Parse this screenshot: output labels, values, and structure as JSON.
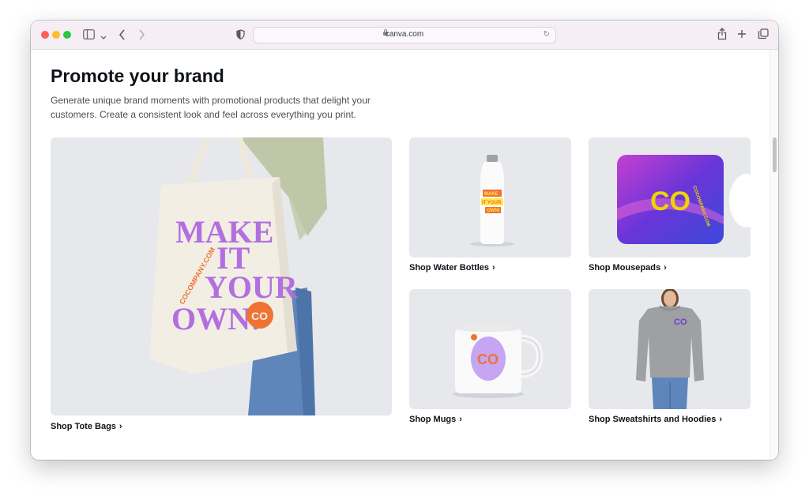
{
  "browser": {
    "url": "canva.com"
  },
  "section": {
    "title": "Promote your brand",
    "description": "Generate unique brand moments with promotional products that delight your customers. Create a consistent look and feel across everything you print."
  },
  "products": [
    {
      "label": "Shop Tote Bags"
    },
    {
      "label": "Shop Water Bottles"
    },
    {
      "label": "Shop Mousepads"
    },
    {
      "label": "Shop Mugs"
    },
    {
      "label": "Shop Sweatshirts and Hoodies"
    }
  ],
  "artwork": {
    "tote_text": [
      "MAKE",
      "IT",
      "YOUR",
      "OWN!"
    ],
    "tote_arc": "COCOMPANY.COM",
    "logo": "CO",
    "bottle_text": [
      "MAKE",
      "IT YOUR",
      "OWN!"
    ],
    "mousepad_arc": "COCOMPANY.COM"
  },
  "colors": {
    "tote_purple": "#b26fe0",
    "logo_orange": "#ef7332",
    "mousepad_yellow": "#ecd500",
    "sweatshirt_logo": "#6b3fd6",
    "card_bg": "#e8eaee"
  }
}
